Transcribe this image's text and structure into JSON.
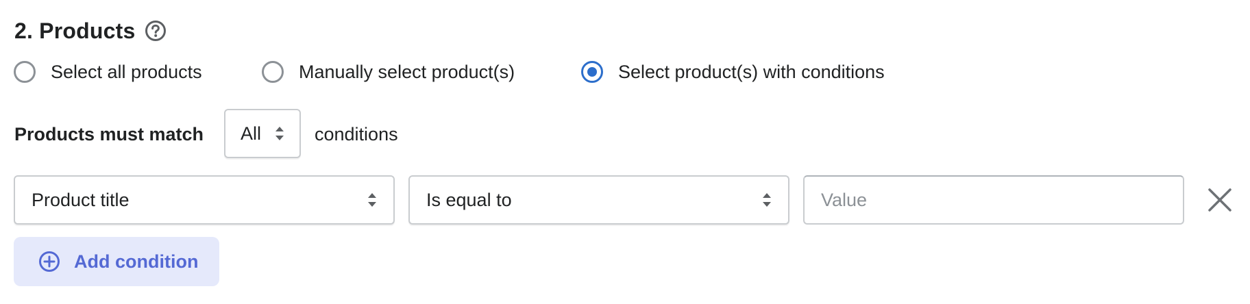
{
  "section": {
    "title": "2. Products",
    "help_icon": "question-circle-icon"
  },
  "selection_mode": {
    "options": [
      {
        "label": "Select all products",
        "checked": false
      },
      {
        "label": "Manually select product(s)",
        "checked": false
      },
      {
        "label": "Select product(s) with conditions",
        "checked": true
      }
    ]
  },
  "match": {
    "label": "Products must match",
    "selected": "All",
    "suffix": "conditions"
  },
  "condition_row": {
    "field": "Product title",
    "operator": "Is equal to",
    "value": "",
    "value_placeholder": "Value",
    "remove_icon": "close-icon"
  },
  "add_condition": {
    "label": "Add condition",
    "icon": "plus-circle-icon"
  },
  "colors": {
    "accent": "#2c6ecb",
    "button_bg": "#e5e9fb",
    "button_text": "#5469d4",
    "border": "#c9cccf"
  }
}
